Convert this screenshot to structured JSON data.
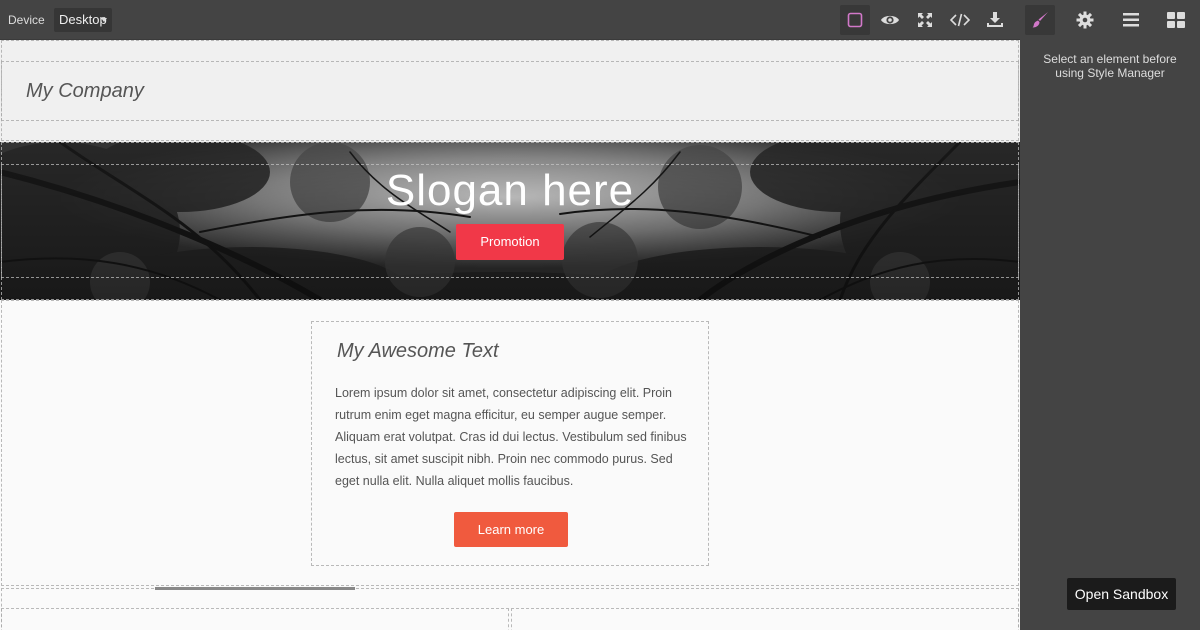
{
  "topbar": {
    "device_label": "Device",
    "device_value": "Desktop",
    "buttons": [
      {
        "icon": "square-outline-icon",
        "active": true
      },
      {
        "icon": "eye-icon",
        "active": false
      },
      {
        "icon": "fullscreen-icon",
        "active": false
      },
      {
        "icon": "code-icon",
        "active": false
      },
      {
        "icon": "download-icon",
        "active": false
      }
    ]
  },
  "panel": {
    "tabs": [
      {
        "icon": "brush-icon",
        "active": true
      },
      {
        "icon": "gear-icon",
        "active": false
      },
      {
        "icon": "layers-icon",
        "active": false
      },
      {
        "icon": "blocks-icon",
        "active": false
      }
    ],
    "message": "Select an element before using Style Manager"
  },
  "sandbox_button": "Open Sandbox",
  "canvas": {
    "company": "My Company",
    "hero": {
      "slogan": "Slogan here",
      "promo_button": "Promotion"
    },
    "card": {
      "title": "My Awesome Text",
      "body": "Lorem ipsum dolor sit amet, consectetur adipiscing elit. Proin rutrum enim eget magna efficitur, eu semper augue semper. Aliquam erat volutpat. Cras id dui lectus. Vestibulum sed finibus lectus, sit amet suscipit nibh. Proin nec commodo purus. Sed eget nulla elit. Nulla aliquet mollis faucibus.",
      "button": "Learn more"
    }
  },
  "colors": {
    "promo": "#f13848",
    "learn_more": "#f05a3e",
    "active_icon": "#d278c9",
    "icon": "#dddddd"
  }
}
